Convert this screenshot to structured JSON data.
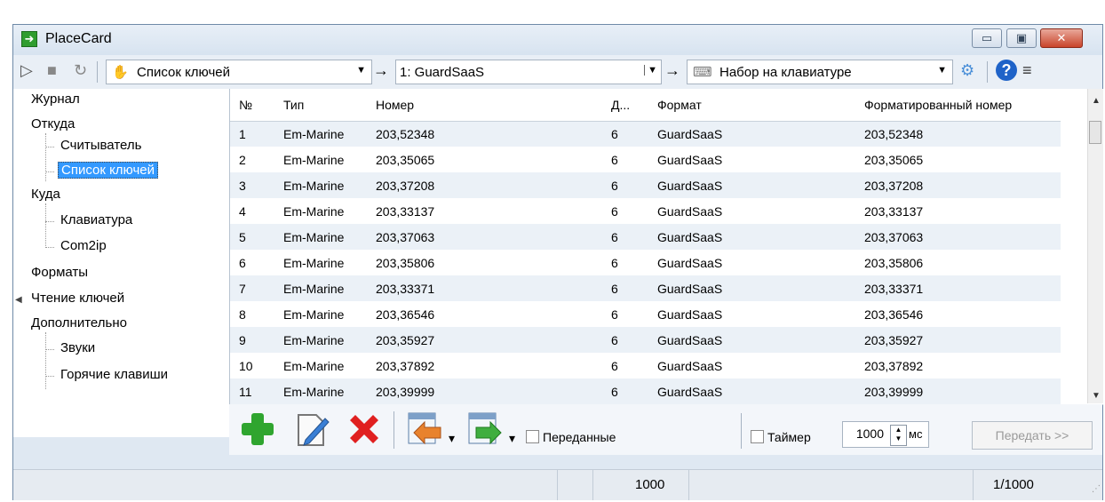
{
  "window": {
    "title": "PlaceCard",
    "minimize": "▭",
    "maximize": "▣",
    "close": "✕"
  },
  "toolbar": {
    "source_combo": "Список ключей",
    "target_combo": "1: GuardSaaS",
    "output_combo": "Набор на клавиатуре",
    "icons": [
      "play-icon",
      "stop-icon",
      "refresh-icon",
      "key-icon",
      "keyboard-icon",
      "settings-icon",
      "help-icon",
      "menu-icon"
    ]
  },
  "sidebar": {
    "journal": "Журнал",
    "from": "Откуда",
    "reader": "Считыватель",
    "key_list": "Список ключей",
    "to": "Куда",
    "keyboard": "Клавиатура",
    "com2ip": "Com2ip",
    "formats": "Форматы",
    "reading": "Чтение ключей",
    "additional": "Дополнительно",
    "sounds": "Звуки",
    "hotkeys": "Горячие клавиши"
  },
  "table": {
    "columns": [
      "№",
      "Тип",
      "Номер",
      "Д...",
      "Формат",
      "Форматированный номер"
    ],
    "rows": [
      [
        "1",
        "Em-Marine",
        "203,52348",
        "6",
        "GuardSaaS",
        "203,52348"
      ],
      [
        "2",
        "Em-Marine",
        "203,35065",
        "6",
        "GuardSaaS",
        "203,35065"
      ],
      [
        "3",
        "Em-Marine",
        "203,37208",
        "6",
        "GuardSaaS",
        "203,37208"
      ],
      [
        "4",
        "Em-Marine",
        "203,33137",
        "6",
        "GuardSaaS",
        "203,33137"
      ],
      [
        "5",
        "Em-Marine",
        "203,37063",
        "6",
        "GuardSaaS",
        "203,37063"
      ],
      [
        "6",
        "Em-Marine",
        "203,35806",
        "6",
        "GuardSaaS",
        "203,35806"
      ],
      [
        "7",
        "Em-Marine",
        "203,33371",
        "6",
        "GuardSaaS",
        "203,33371"
      ],
      [
        "8",
        "Em-Marine",
        "203,36546",
        "6",
        "GuardSaaS",
        "203,36546"
      ],
      [
        "9",
        "Em-Marine",
        "203,35927",
        "6",
        "GuardSaaS",
        "203,35927"
      ],
      [
        "10",
        "Em-Marine",
        "203,37892",
        "6",
        "GuardSaaS",
        "203,37892"
      ],
      [
        "11",
        "Em-Marine",
        "203,39999",
        "6",
        "GuardSaaS",
        "203,39999"
      ]
    ]
  },
  "actions": {
    "sent_label": "Переданные",
    "timer_label": "Таймер",
    "timer_value": "1000",
    "timer_unit": "мс",
    "send_button": "Передать >>"
  },
  "status": {
    "count": "1000",
    "position": "1/1000"
  },
  "colors": {
    "selection": "#3399ff",
    "add": "#2fa52f",
    "delete": "#e02020",
    "edit": "#3a7fd5"
  }
}
